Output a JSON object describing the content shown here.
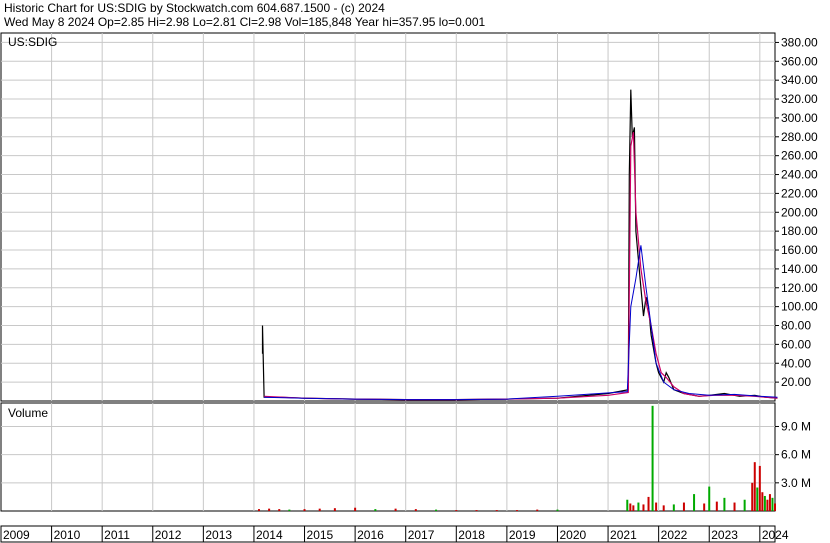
{
  "header": {
    "line1": "Historic Chart for US:SDIG by Stockwatch.com 604.687.1500 - (c) 2024",
    "line2": "Wed May  8 2024   Op=2.85  Hi=2.98  Lo=2.81  Cl=2.98  Vol=185,848  Year hi=357.95  lo=0.001"
  },
  "colors": {
    "ma_fast": "#cc0066",
    "ma_slow": "#0000cc",
    "price_bar": "#000000",
    "vol_up": "#00aa00",
    "vol_down": "#cc0000",
    "grid": "#c8c8c8"
  },
  "chart_data": [
    {
      "type": "line",
      "panel": "price",
      "title": "US:SDIG",
      "ylim": [
        0,
        390
      ],
      "yticks": [
        "380.00",
        "360.00",
        "340.00",
        "320.00",
        "300.00",
        "280.00",
        "260.00",
        "240.00",
        "220.00",
        "200.00",
        "180.00",
        "160.00",
        "140.00",
        "120.00",
        "100.00",
        "80.00",
        "60.00",
        "40.00",
        "20.00"
      ],
      "ytick_values": [
        380,
        360,
        340,
        320,
        300,
        280,
        260,
        240,
        220,
        200,
        180,
        160,
        140,
        120,
        100,
        80,
        60,
        40,
        20
      ],
      "grid": true,
      "series": [
        {
          "role": "price",
          "points": [
            [
              2014.17,
              50
            ],
            [
              2014.17,
              80
            ],
            [
              2014.2,
              4
            ],
            [
              2014.5,
              4
            ],
            [
              2015,
              3
            ],
            [
              2016,
              2
            ],
            [
              2017,
              1.5
            ],
            [
              2018,
              1.5
            ],
            [
              2019,
              2
            ],
            [
              2020,
              3
            ],
            [
              2021,
              8
            ],
            [
              2021.4,
              12
            ],
            [
              2021.42,
              240
            ],
            [
              2021.45,
              330
            ],
            [
              2021.48,
              280
            ],
            [
              2021.52,
              290
            ],
            [
              2021.55,
              180
            ],
            [
              2021.6,
              150
            ],
            [
              2021.65,
              120
            ],
            [
              2021.7,
              90
            ],
            [
              2021.75,
              110
            ],
            [
              2021.8,
              100
            ],
            [
              2021.85,
              70
            ],
            [
              2021.9,
              55
            ],
            [
              2021.95,
              40
            ],
            [
              2022,
              30
            ],
            [
              2022.05,
              25
            ],
            [
              2022.1,
              20
            ],
            [
              2022.15,
              30
            ],
            [
              2022.2,
              25
            ],
            [
              2022.3,
              12
            ],
            [
              2022.5,
              8
            ],
            [
              2022.8,
              5
            ],
            [
              2023,
              6
            ],
            [
              2023.3,
              8
            ],
            [
              2023.6,
              5
            ],
            [
              2023.9,
              6
            ],
            [
              2024.1,
              4
            ],
            [
              2024.35,
              3
            ]
          ]
        },
        {
          "role": "moving-average-fast",
          "points": [
            [
              2014.2,
              5
            ],
            [
              2015,
              3
            ],
            [
              2016,
              2
            ],
            [
              2017,
              1.5
            ],
            [
              2018,
              1.5
            ],
            [
              2019,
              2
            ],
            [
              2020,
              3
            ],
            [
              2021,
              6
            ],
            [
              2021.4,
              9
            ],
            [
              2021.45,
              270
            ],
            [
              2021.5,
              285
            ],
            [
              2021.55,
              200
            ],
            [
              2021.65,
              140
            ],
            [
              2021.75,
              105
            ],
            [
              2021.85,
              80
            ],
            [
              2021.95,
              50
            ],
            [
              2022.05,
              30
            ],
            [
              2022.15,
              25
            ],
            [
              2022.3,
              15
            ],
            [
              2022.5,
              8
            ],
            [
              2022.8,
              5
            ],
            [
              2023.1,
              6
            ],
            [
              2023.5,
              6
            ],
            [
              2023.9,
              5
            ],
            [
              2024.35,
              3
            ]
          ]
        },
        {
          "role": "moving-average-slow",
          "points": [
            [
              2014.2,
              4
            ],
            [
              2015,
              3
            ],
            [
              2016,
              2
            ],
            [
              2017,
              1.5
            ],
            [
              2018,
              1.5
            ],
            [
              2019,
              2
            ],
            [
              2020,
              5
            ],
            [
              2021.38,
              10
            ],
            [
              2021.45,
              100
            ],
            [
              2021.55,
              130
            ],
            [
              2021.65,
              165
            ],
            [
              2021.75,
              120
            ],
            [
              2021.85,
              80
            ],
            [
              2021.95,
              40
            ],
            [
              2022.1,
              20
            ],
            [
              2022.3,
              12
            ],
            [
              2022.6,
              8
            ],
            [
              2023,
              6
            ],
            [
              2023.5,
              7
            ],
            [
              2024,
              5
            ],
            [
              2024.35,
              4
            ]
          ]
        }
      ]
    },
    {
      "type": "bar",
      "panel": "volume",
      "title": "Volume",
      "ylim": [
        0,
        11.5
      ],
      "yticks": [
        "9.0 M",
        "6.0 M",
        "3.0 M"
      ],
      "ytick_values": [
        9,
        6,
        3
      ],
      "x": [
        2014.1,
        2014.3,
        2014.5,
        2014.7,
        2015.0,
        2015.3,
        2015.6,
        2016.0,
        2016.4,
        2016.8,
        2017.2,
        2017.6,
        2018.0,
        2018.4,
        2018.8,
        2019.2,
        2019.6,
        2020.0,
        2021.38,
        2021.44,
        2021.5,
        2021.6,
        2021.7,
        2021.8,
        2021.88,
        2021.95,
        2022.1,
        2022.3,
        2022.5,
        2022.7,
        2022.9,
        2023.0,
        2023.15,
        2023.3,
        2023.5,
        2023.7,
        2023.85,
        2023.9,
        2023.95,
        2024.0,
        2024.05,
        2024.1,
        2024.15,
        2024.2,
        2024.25,
        2024.3
      ],
      "values": [
        0.2,
        0.25,
        0.2,
        0.15,
        0.2,
        0.25,
        0.3,
        0.35,
        0.2,
        0.25,
        0.2,
        0.15,
        0.1,
        0.1,
        0.1,
        0.1,
        0.15,
        0.15,
        1.2,
        0.8,
        0.6,
        0.9,
        0.7,
        1.5,
        11.2,
        0.9,
        0.6,
        0.7,
        0.9,
        1.8,
        0.8,
        2.6,
        1.0,
        1.4,
        0.9,
        1.2,
        3.0,
        5.2,
        2.5,
        4.8,
        2.0,
        1.6,
        1.2,
        1.8,
        1.4,
        0.8
      ],
      "colors": [
        "vol_down",
        "vol_down",
        "vol_down",
        "vol_up",
        "vol_down",
        "vol_down",
        "vol_down",
        "vol_down",
        "vol_up",
        "vol_down",
        "vol_down",
        "vol_up",
        "vol_down",
        "vol_down",
        "vol_down",
        "vol_down",
        "vol_down",
        "vol_up",
        "vol_up",
        "vol_down",
        "vol_down",
        "vol_up",
        "vol_down",
        "vol_down",
        "vol_up",
        "vol_down",
        "vol_down",
        "vol_up",
        "vol_down",
        "vol_up",
        "vol_down",
        "vol_up",
        "vol_down",
        "vol_up",
        "vol_down",
        "vol_up",
        "vol_down",
        "vol_down",
        "vol_up",
        "vol_down",
        "vol_down",
        "vol_up",
        "vol_down",
        "vol_down",
        "vol_up",
        "vol_down"
      ]
    },
    {
      "type": "table",
      "panel": "x-axis",
      "xlim": [
        2009,
        2024.3
      ],
      "categories": [
        "2009",
        "2010",
        "2011",
        "2012",
        "2013",
        "2014",
        "2015",
        "2016",
        "2017",
        "2018",
        "2019",
        "2020",
        "2021",
        "2022",
        "2023",
        "2024"
      ]
    }
  ]
}
